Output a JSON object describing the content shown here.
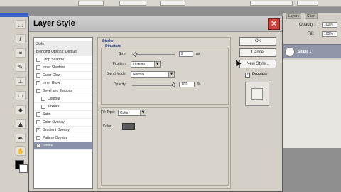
{
  "dialog": {
    "title": "Layer Style",
    "close_glyph": "✕",
    "buttons": {
      "ok": "Ok",
      "cancel": "Cancel",
      "new_style": "New Style..."
    },
    "preview_label": "Preview",
    "preview_checked": true
  },
  "styles_list": [
    {
      "label": "Style",
      "type": "header",
      "checked": null,
      "selected": false
    },
    {
      "label": "Blending Options: Default",
      "type": "header",
      "checked": null,
      "selected": false
    },
    {
      "label": "Drop Shadow",
      "type": "item",
      "checked": false,
      "selected": false
    },
    {
      "label": "Inner Shadow",
      "type": "item",
      "checked": false,
      "selected": false
    },
    {
      "label": "Outer Glow",
      "type": "item",
      "checked": false,
      "selected": false
    },
    {
      "label": "Inner Glow",
      "type": "item",
      "checked": true,
      "selected": false
    },
    {
      "label": "Bevel and Emboss",
      "type": "item",
      "checked": false,
      "selected": false
    },
    {
      "label": "Contour",
      "type": "sub",
      "checked": false,
      "selected": false
    },
    {
      "label": "Texture",
      "type": "sub",
      "checked": false,
      "selected": false
    },
    {
      "label": "Satin",
      "type": "item",
      "checked": false,
      "selected": false
    },
    {
      "label": "Color Overlay",
      "type": "item",
      "checked": false,
      "selected": false
    },
    {
      "label": "Gradient Overlay",
      "type": "item",
      "checked": true,
      "selected": false
    },
    {
      "label": "Pattern Overlay",
      "type": "item",
      "checked": false,
      "selected": false
    },
    {
      "label": "Stroke",
      "type": "item",
      "checked": true,
      "selected": true
    }
  ],
  "stroke": {
    "section_title": "Stroke",
    "structure_title": "Structure",
    "size_label": "Size:",
    "size_value": "2",
    "size_unit": "px",
    "position_label": "Position:",
    "position_value": "Outside",
    "blend_label": "Blend Mode:",
    "blend_value": "Normal",
    "opacity_label": "Opacity:",
    "opacity_value": "100",
    "opacity_unit": "%",
    "fill_type_label": "Fill Type:",
    "fill_type_value": "Color",
    "color_label": "Color:",
    "color_value": "#5a5a5a"
  },
  "layers_panel": {
    "tabs": [
      "Layers",
      "Chan"
    ],
    "opacity_label": "Opacity:",
    "opacity_value": "100%",
    "fill_label": "Fill:",
    "fill_value": "100%",
    "layer_name": "Shape 1"
  },
  "colors": {
    "title_bar": "#c4c4c4",
    "close": "#c8413a",
    "selected_row": "#8a92aa"
  }
}
